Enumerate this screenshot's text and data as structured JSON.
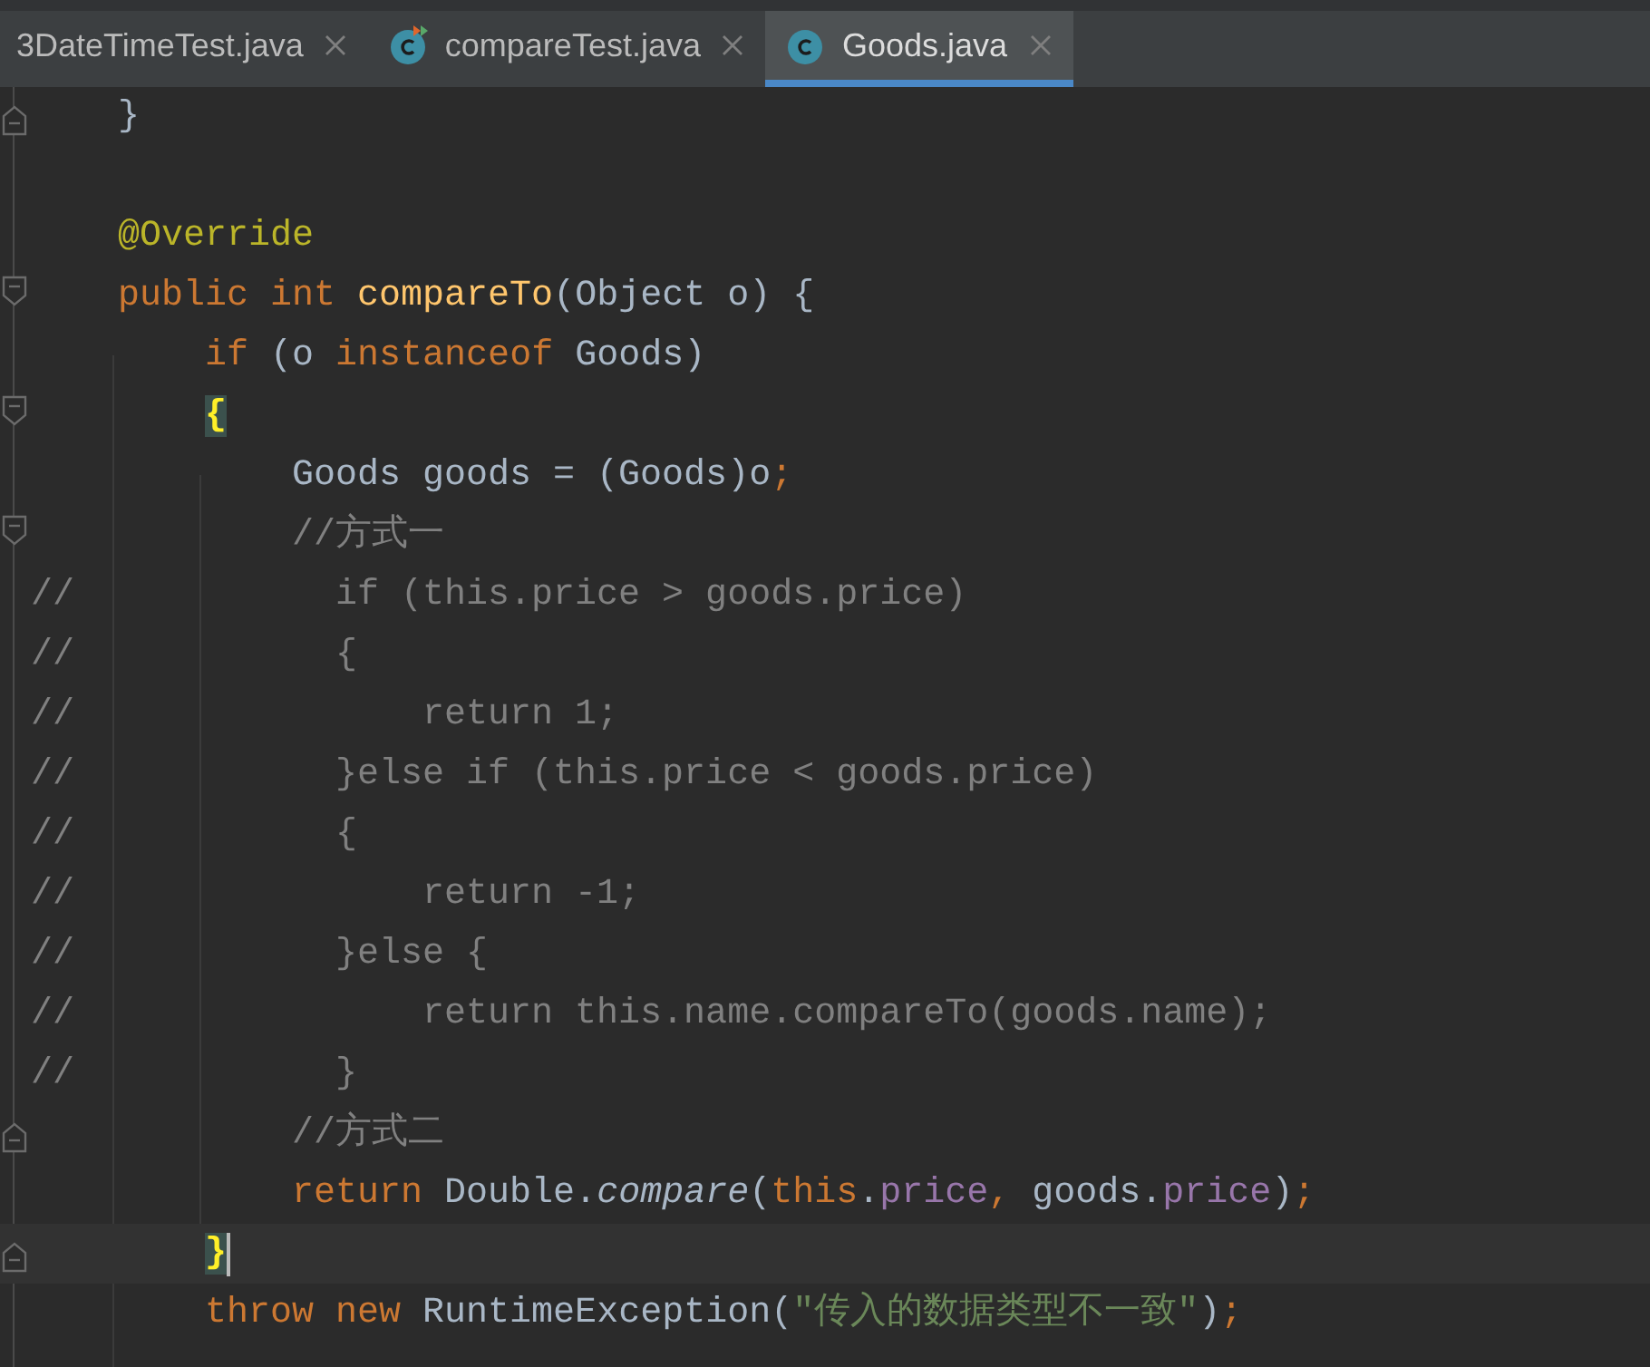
{
  "tabs": [
    {
      "label": "3DateTimeTest.java",
      "selected": false
    },
    {
      "label": "compareTest.java",
      "selected": false,
      "kind": "runnable-class"
    },
    {
      "label": "Goods.java",
      "selected": true,
      "kind": "class"
    }
  ],
  "editor": {
    "lines": [
      {
        "kind": "fold-end",
        "tokens": [
          {
            "text": "    }",
            "kind": "plain"
          }
        ]
      },
      {
        "kind": "blank"
      },
      {
        "tokens": [
          {
            "text": "    @Override",
            "kind": "annotation"
          }
        ]
      },
      {
        "kind": "fold-start",
        "tokens": [
          {
            "text": "    public int ",
            "kind": "keyword"
          },
          {
            "text": "compareTo",
            "kind": "method"
          },
          {
            "text": "(Object o) {",
            "kind": "plain"
          }
        ]
      },
      {
        "tokens": [
          {
            "text": "        if ",
            "kind": "keyword"
          },
          {
            "text": "(o ",
            "kind": "plain"
          },
          {
            "text": "instanceof ",
            "kind": "keyword"
          },
          {
            "text": "Goods)",
            "kind": "plain"
          }
        ]
      },
      {
        "kind": "fold-start",
        "tokens": [
          {
            "text": "{",
            "kind": "brace-match"
          }
        ]
      },
      {
        "tokens": [
          {
            "text": "            Goods goods = (Goods)o",
            "kind": "plain"
          },
          {
            "text": ";",
            "kind": "keyword"
          }
        ]
      },
      {
        "kind": "fold-start",
        "tokens": [
          {
            "text": "            //方式一",
            "kind": "comment"
          }
        ]
      },
      {
        "tokens": [
          {
            "text": "//            if (this.price > goods.price)",
            "kind": "comment"
          }
        ]
      },
      {
        "tokens": [
          {
            "text": "//            {",
            "kind": "comment"
          }
        ]
      },
      {
        "tokens": [
          {
            "text": "//                return 1;",
            "kind": "comment"
          }
        ]
      },
      {
        "tokens": [
          {
            "text": "//            }else if (this.price < goods.price)",
            "kind": "comment"
          }
        ]
      },
      {
        "tokens": [
          {
            "text": "//            {",
            "kind": "comment"
          }
        ]
      },
      {
        "tokens": [
          {
            "text": "//                return -1;",
            "kind": "comment"
          }
        ]
      },
      {
        "tokens": [
          {
            "text": "//            }else {",
            "kind": "comment"
          }
        ]
      },
      {
        "tokens": [
          {
            "text": "//                return this.name.compareTo(goods.name);",
            "kind": "comment"
          }
        ]
      },
      {
        "tokens": [
          {
            "text": "//            }",
            "kind": "comment"
          }
        ]
      },
      {
        "kind": "fold-end",
        "tokens": [
          {
            "text": "            //方式二",
            "kind": "comment"
          }
        ]
      },
      {
        "tokens": [
          {
            "text": "            return ",
            "kind": "keyword"
          },
          {
            "text": "Double.",
            "kind": "plain"
          },
          {
            "text": "compare",
            "kind": "static-call"
          },
          {
            "text": "(",
            "kind": "plain"
          },
          {
            "text": "this",
            "kind": "keyword"
          },
          {
            "text": ".",
            "kind": "plain"
          },
          {
            "text": "price",
            "kind": "field"
          },
          {
            "text": ", ",
            "kind": "keyword"
          },
          {
            "text": "goods.",
            "kind": "plain"
          },
          {
            "text": "price",
            "kind": "field"
          },
          {
            "text": ")",
            "kind": "plain"
          },
          {
            "text": ";",
            "kind": "keyword"
          }
        ]
      },
      {
        "kind": "fold-end",
        "current": true,
        "tokens": [
          {
            "text": "}",
            "kind": "brace-match"
          }
        ]
      },
      {
        "tokens": [
          {
            "text": "        throw new ",
            "kind": "keyword"
          },
          {
            "text": "RuntimeException(",
            "kind": "plain"
          },
          {
            "text": "\"传入的数据类型不一致\"",
            "kind": "string"
          },
          {
            "text": ")",
            "kind": "plain"
          },
          {
            "text": ";",
            "kind": "keyword"
          }
        ]
      }
    ]
  }
}
